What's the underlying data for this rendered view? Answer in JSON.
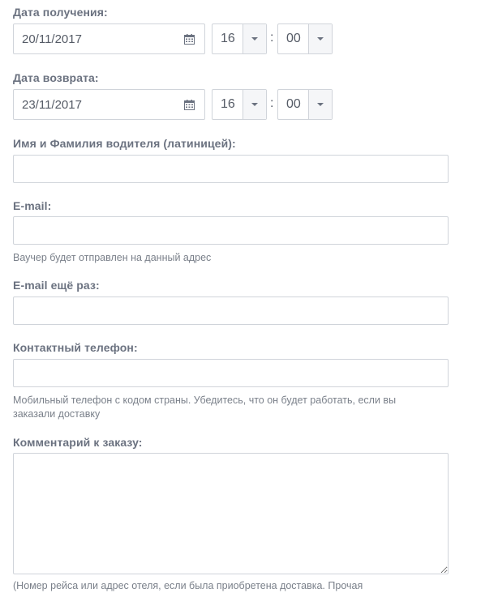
{
  "pickup": {
    "label": "Дата получения:",
    "date": "20/11/2017",
    "hour": "16",
    "minute": "00",
    "separator": ":"
  },
  "return": {
    "label": "Дата возврата:",
    "date": "23/11/2017",
    "hour": "16",
    "minute": "00",
    "separator": ":"
  },
  "driver_name": {
    "label": "Имя и Фамилия водителя (латиницей):",
    "value": ""
  },
  "email": {
    "label": "E-mail:",
    "value": "",
    "hint": "Ваучер будет отправлен на данный адрес"
  },
  "email_confirm": {
    "label": "E-mail ещё раз:",
    "value": ""
  },
  "phone": {
    "label": "Контактный телефон:",
    "value": "",
    "hint": "Мобильный телефон с кодом страны. Убедитесь, что он будет работать, если вы заказали доставку"
  },
  "comment": {
    "label": "Комментарий к заказу:",
    "value": "",
    "hint": "(Номер рейса или адрес отеля, если была приобретена доставка. Прочая"
  }
}
